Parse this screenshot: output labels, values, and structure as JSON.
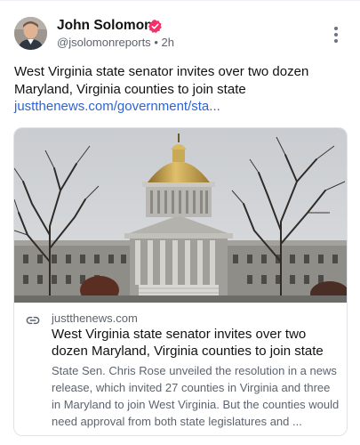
{
  "author": {
    "name": "John Solomon",
    "handle": "@jsolomonreports",
    "separator": "•",
    "time": "2h",
    "verified_color": "#f2316b"
  },
  "post": {
    "text": "West Virginia state senator invites over two dozen Maryland, Virginia counties to join state",
    "link_text": "justthenews.com/government/sta..."
  },
  "card": {
    "domain": "justthenews.com",
    "title": "West Virginia state senator invites over two dozen Maryland, Virginia counties to join state",
    "description": "State Sen. Chris Rose unveiled the resolution in a news release, which invited 27 counties in Virginia and three in Maryland to join West Virginia. But the counties would need approval from both state legislatures and ..."
  },
  "colors": {
    "link": "#2b63d9",
    "muted_text": "#5d6470",
    "border": "#dfe3e8"
  },
  "icons": {
    "verified": "verified-badge-icon",
    "more": "more-vertical-icon",
    "link": "link-icon"
  }
}
